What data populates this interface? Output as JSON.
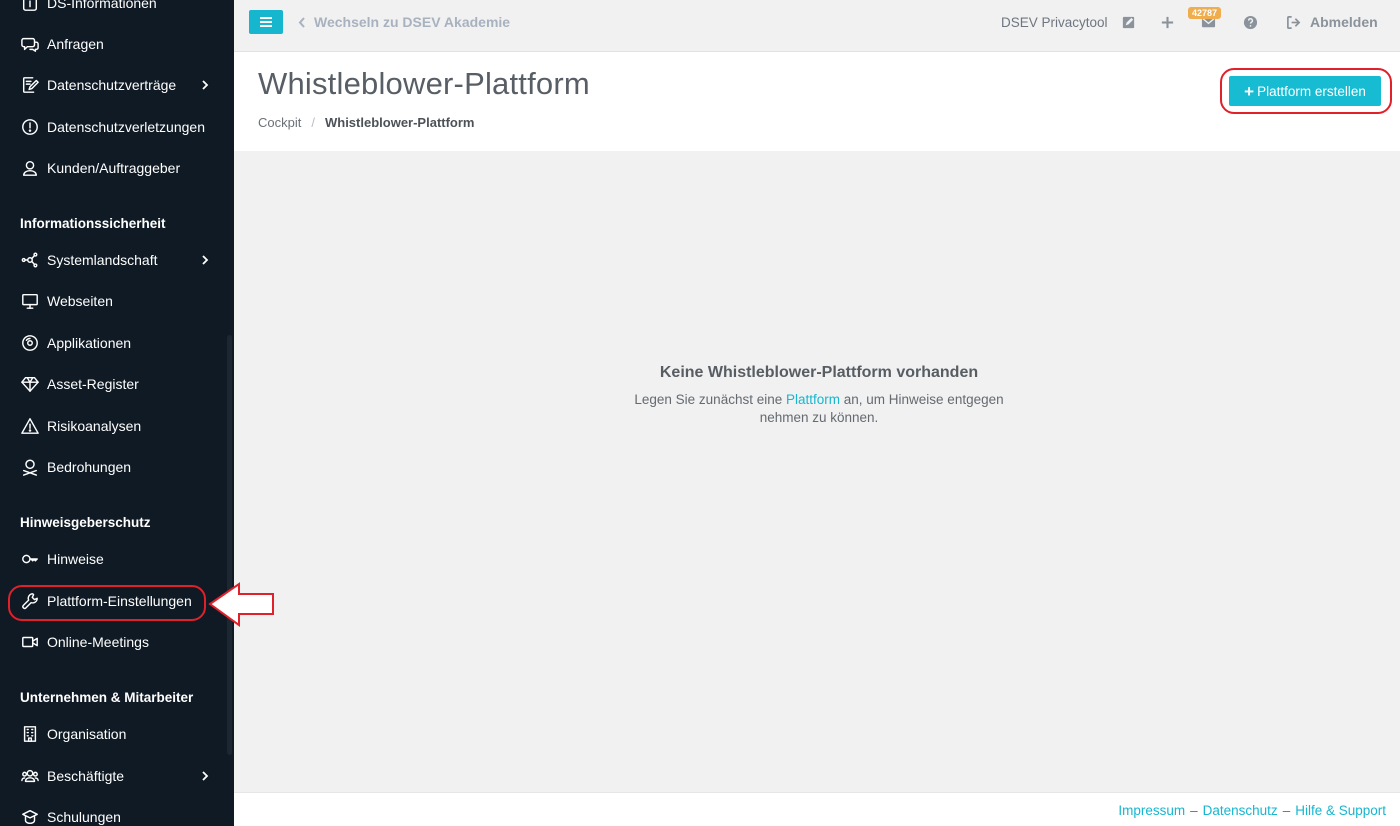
{
  "sidebar": {
    "items": [
      {
        "label": "DS-Informationen",
        "icon": "info-square-icon"
      },
      {
        "label": "Anfragen",
        "icon": "chat-icon"
      },
      {
        "label": "Datenschutzverträge",
        "icon": "contract-edit-icon",
        "has_submenu": true
      },
      {
        "label": "Datenschutzverletzungen",
        "icon": "alert-circle-icon"
      },
      {
        "label": "Kunden/Auftraggeber",
        "icon": "user-icon"
      },
      {
        "label": "Systemlandschaft",
        "icon": "network-icon",
        "has_submenu": true
      },
      {
        "label": "Webseiten",
        "icon": "monitor-icon"
      },
      {
        "label": "Applikationen",
        "icon": "app-disc-icon"
      },
      {
        "label": "Asset-Register",
        "icon": "diamond-icon"
      },
      {
        "label": "Risikoanalysen",
        "icon": "warning-triangle-icon"
      },
      {
        "label": "Bedrohungen",
        "icon": "skull-user-icon"
      },
      {
        "label": "Hinweise",
        "icon": "key-icon"
      },
      {
        "label": "Plattform-Einstellungen",
        "icon": "wrench-icon"
      },
      {
        "label": "Online-Meetings",
        "icon": "video-icon"
      },
      {
        "label": "Organisation",
        "icon": "building-icon"
      },
      {
        "label": "Beschäftigte",
        "icon": "users-icon",
        "has_submenu": true
      },
      {
        "label": "Schulungen",
        "icon": "training-icon"
      }
    ],
    "sections": {
      "infosec": "Informationssicherheit",
      "whistle": "Hinweisgeberschutz",
      "company": "Unternehmen & Mitarbeiter"
    }
  },
  "topbar": {
    "switch_label": "Wechseln zu DSEV Akademie",
    "tool_name": "DSEV Privacytool",
    "badge_count": "42787",
    "logout_label": "Abmelden"
  },
  "page": {
    "title": "Whistleblower-Plattform",
    "breadcrumb": [
      "Cockpit",
      "Whistleblower-Plattform"
    ],
    "create_button": "Plattform erstellen"
  },
  "empty_state": {
    "title": "Keine Whistleblower-Plattform vorhanden",
    "text_before": "Legen Sie zunächst eine ",
    "link_text": "Plattform",
    "text_after": " an, um Hinweise entgegen nehmen zu können."
  },
  "footer": {
    "links": [
      "Impressum",
      "Datenschutz",
      "Hilfe & Support"
    ],
    "separator": "–"
  },
  "colors": {
    "sidebar_bg": "#0f1a24",
    "accent": "#17bcd3",
    "annotation_red": "#e0202a",
    "badge": "#f0ad4e"
  }
}
